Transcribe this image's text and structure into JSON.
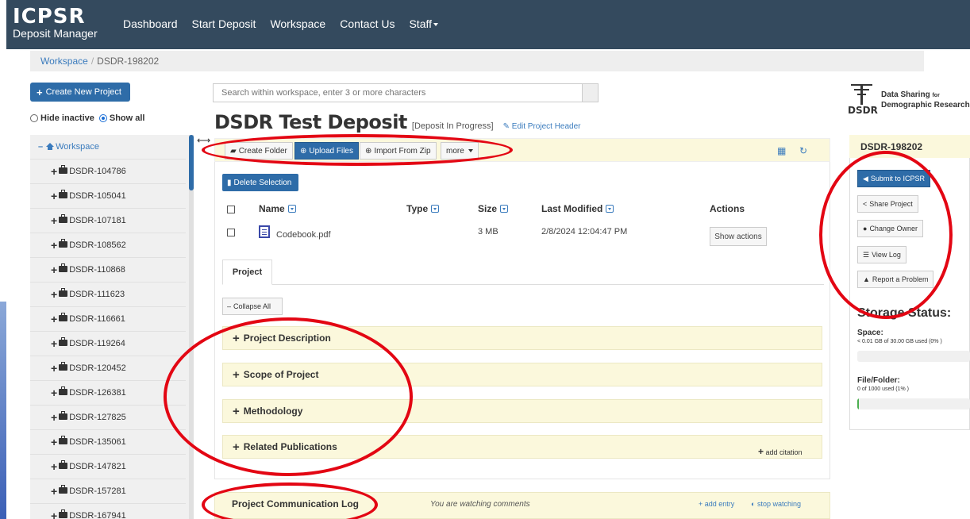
{
  "nav": {
    "brand_title": "ICPSR",
    "brand_sub": "Deposit Manager",
    "links": [
      "Dashboard",
      "Start Deposit",
      "Workspace",
      "Contact Us",
      "Staff"
    ]
  },
  "breadcrumb": {
    "root": "Workspace",
    "separator": "/",
    "current": "DSDR-198202"
  },
  "left": {
    "create_button": "Create New Project",
    "hide_inactive": "Hide inactive",
    "show_all": "Show all",
    "tree_root": "Workspace",
    "tree_items": [
      "DSDR-104786",
      "DSDR-105041",
      "DSDR-107181",
      "DSDR-108562",
      "DSDR-110868",
      "DSDR-111623",
      "DSDR-116661",
      "DSDR-119264",
      "DSDR-120452",
      "DSDR-126381",
      "DSDR-127825",
      "DSDR-135061",
      "DSDR-147821",
      "DSDR-157281",
      "DSDR-167941"
    ]
  },
  "search": {
    "placeholder": "Search within workspace, enter 3 or more characters"
  },
  "project": {
    "title": "DSDR Test Deposit",
    "status": "[Deposit In Progress]",
    "edit_header": "Edit Project Header"
  },
  "toolbar": {
    "create_folder": "Create Folder",
    "upload_files": "Upload Files",
    "import_zip": "Import From Zip",
    "more": "more"
  },
  "files": {
    "delete_selection": "Delete Selection",
    "columns": {
      "name": "Name",
      "type": "Type",
      "size": "Size",
      "modified": "Last Modified",
      "actions": "Actions"
    },
    "rows": [
      {
        "name": "Codebook.pdf",
        "type": "",
        "size": "3 MB",
        "modified": "2/8/2024 12:04:47 PM",
        "action": "Show actions"
      }
    ]
  },
  "tabs": {
    "project": "Project"
  },
  "sections": {
    "collapse_all": "Collapse All",
    "items": [
      "Project Description",
      "Scope of Project",
      "Methodology",
      "Related Publications"
    ],
    "add_citation": "add citation"
  },
  "comm_log": {
    "title": "Project Communication Log",
    "watching": "You are watching comments",
    "add_entry": "add entry",
    "stop_watching": "stop watching"
  },
  "logo": {
    "left": "DSDR",
    "line1": "Data Sharing",
    "for": "for",
    "line2": "Demographic Research"
  },
  "side": {
    "heading": "DSDR-198202",
    "submit": "Submit to ICPSR",
    "share": "Share Project",
    "change_owner": "Change Owner",
    "view_log": "View Log",
    "report": "Report a Problem",
    "storage_title": "Storage Status:",
    "space_label": "Space:",
    "space_detail": "< 0.01 GB of 30.00 GB used (0% )",
    "space_pct": 0,
    "file_label": "File/Folder:",
    "file_detail": "0 of 1000 used (1% )",
    "file_pct": 1
  },
  "colors": {
    "nav": "#344a5e",
    "primary": "#2e6ca8",
    "highlight": "#fbf8dc",
    "annotation": "#e30613"
  }
}
